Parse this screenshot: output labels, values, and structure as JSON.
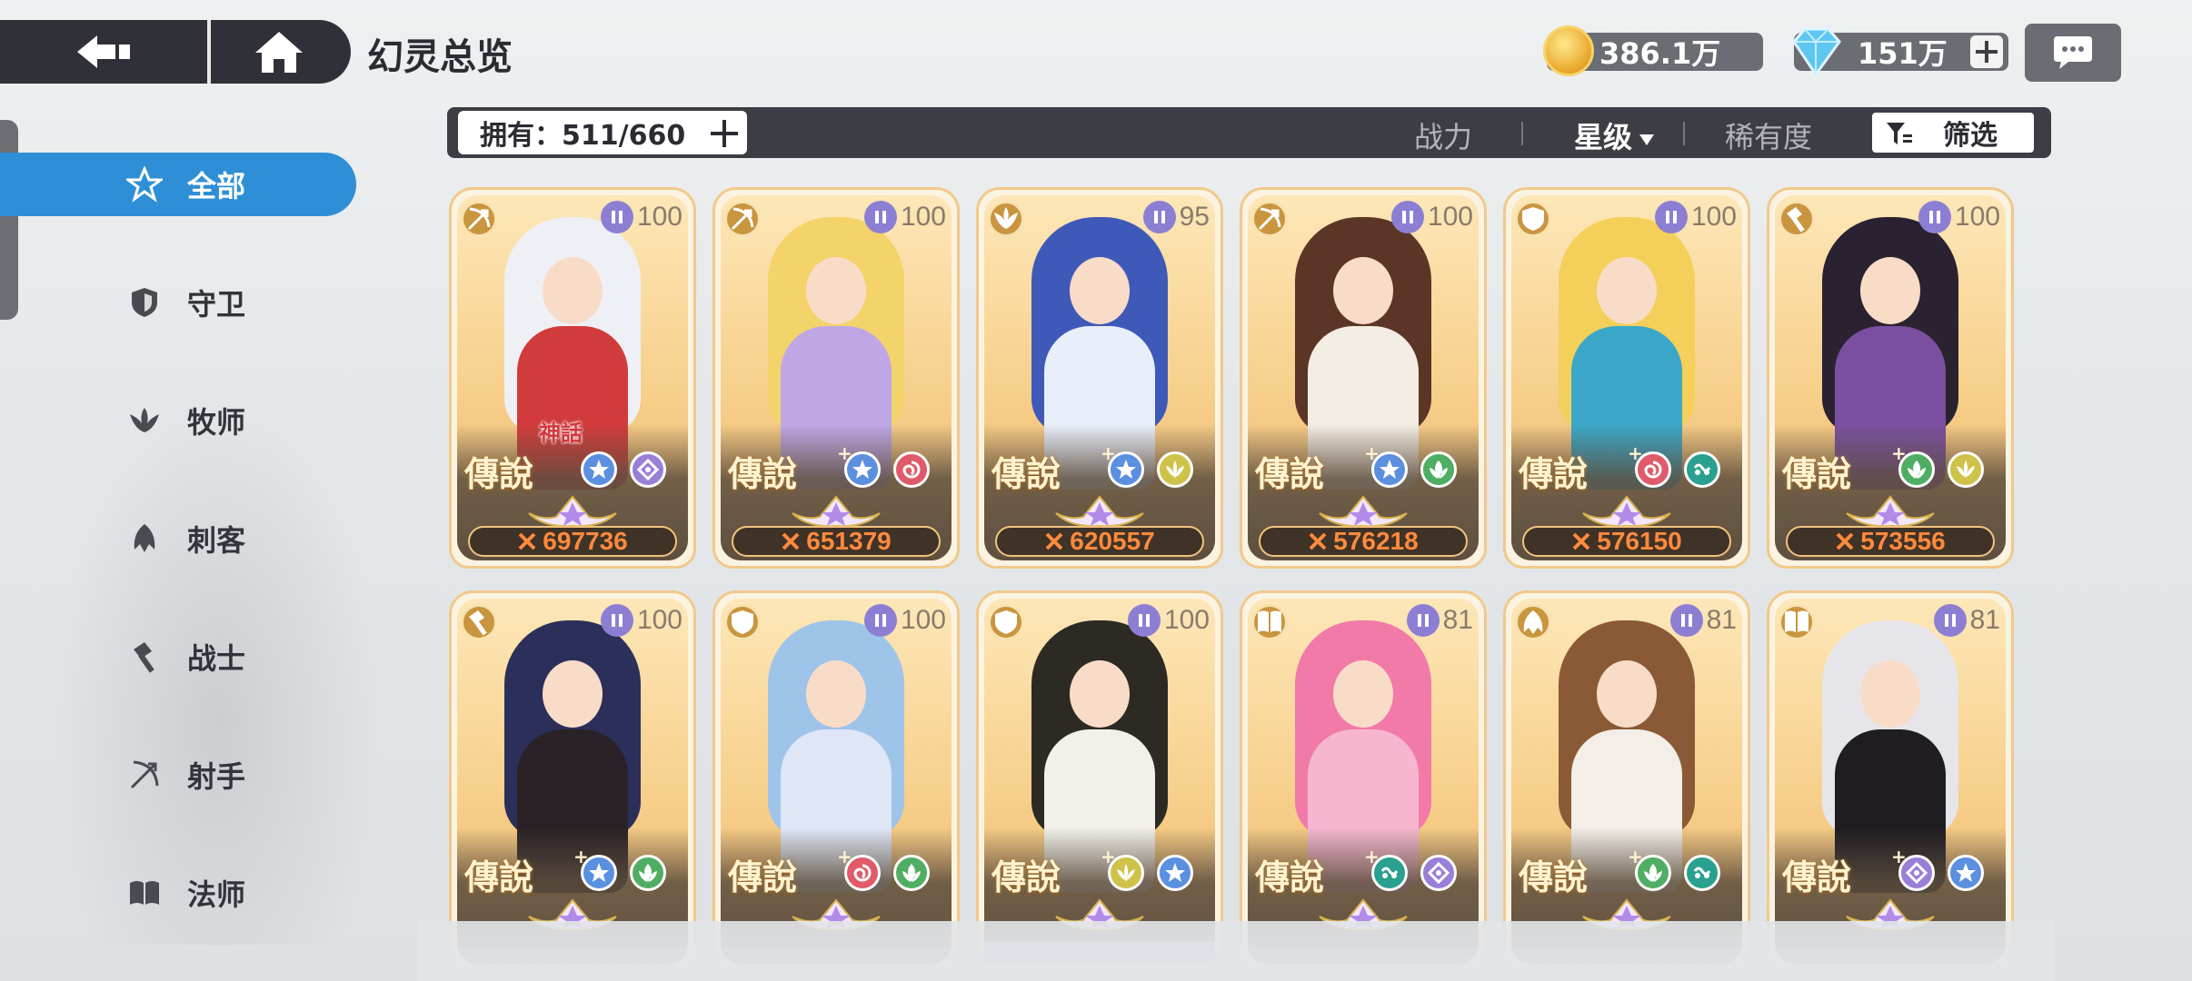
{
  "header": {
    "title": "幻灵总览",
    "gold": "386.1万",
    "gems": "151万"
  },
  "sidebar": {
    "items": [
      {
        "label": "全部",
        "icon": "all-star-icon",
        "active": true
      },
      {
        "label": "守卫",
        "icon": "shield-icon",
        "active": false
      },
      {
        "label": "牧师",
        "icon": "wing-icon",
        "active": false
      },
      {
        "label": "刺客",
        "icon": "assassin-icon",
        "active": false
      },
      {
        "label": "战士",
        "icon": "hammer-icon",
        "active": false
      },
      {
        "label": "射手",
        "icon": "bow-icon",
        "active": false
      },
      {
        "label": "法师",
        "icon": "book-icon",
        "active": false
      }
    ]
  },
  "filter_bar": {
    "owned": "拥有：511/660",
    "sort_power": "战力",
    "sort_star": "星级",
    "sort_rarity": "稀有度",
    "filter": "筛选",
    "active_sort": "星级"
  },
  "cards": [
    {
      "level": "100",
      "class_icon": "bow-icon",
      "rarity": "傳說",
      "plus": "",
      "myth": "神話",
      "elements": [
        "star-element-icon",
        "eye-element-icon"
      ],
      "power": "697736",
      "hair": "#eef0f6",
      "body": "#d23b3b"
    },
    {
      "level": "100",
      "class_icon": "bow-icon",
      "rarity": "傳說",
      "plus": "+",
      "myth": "",
      "elements": [
        "star-element-icon",
        "swirl-element-icon"
      ],
      "power": "651379",
      "hair": "#f3d36a",
      "body": "#bfa7e6"
    },
    {
      "level": "95",
      "class_icon": "wing-icon",
      "rarity": "傳說",
      "plus": "+",
      "myth": "",
      "elements": [
        "star-element-icon",
        "light-element-icon"
      ],
      "power": "620557",
      "hair": "#3f59b8",
      "body": "#e9eefb"
    },
    {
      "level": "100",
      "class_icon": "bow-icon",
      "rarity": "傳說",
      "plus": "+",
      "myth": "",
      "elements": [
        "star-element-icon",
        "leaf-element-icon"
      ],
      "power": "576218",
      "hair": "#5b3526",
      "body": "#f4ede3"
    },
    {
      "level": "100",
      "class_icon": "shield-icon",
      "rarity": "傳說",
      "plus": "+",
      "myth": "",
      "elements": [
        "swirl-element-icon",
        "wind-element-icon"
      ],
      "power": "576150",
      "hair": "#f4cf5a",
      "body": "#3aa7c9"
    },
    {
      "level": "100",
      "class_icon": "hammer-icon",
      "rarity": "傳說",
      "plus": "+",
      "myth": "",
      "elements": [
        "leaf-element-icon",
        "light-element-icon"
      ],
      "power": "573556",
      "hair": "#2a2230",
      "body": "#7b4fa0"
    },
    {
      "level": "100",
      "class_icon": "hammer-icon",
      "rarity": "傳說",
      "plus": "+",
      "myth": "",
      "elements": [
        "star-element-icon",
        "leaf-element-icon"
      ],
      "power": "",
      "hair": "#2c2f5a",
      "body": "#2a2226"
    },
    {
      "level": "100",
      "class_icon": "shield-icon",
      "rarity": "傳說",
      "plus": "+",
      "myth": "",
      "elements": [
        "swirl-element-icon",
        "leaf-element-icon"
      ],
      "power": "",
      "hair": "#9fc4ea",
      "body": "#dfe6f6"
    },
    {
      "level": "100",
      "class_icon": "shield-icon",
      "rarity": "傳說",
      "plus": "+",
      "myth": "",
      "elements": [
        "light-element-icon",
        "star-element-icon"
      ],
      "power": "",
      "hair": "#2d2a24",
      "body": "#f2f0ea"
    },
    {
      "level": "81",
      "class_icon": "book-icon",
      "rarity": "傳說",
      "plus": "+",
      "myth": "",
      "elements": [
        "wind-element-icon",
        "eye-element-icon"
      ],
      "power": "",
      "hair": "#f27aa8",
      "body": "#f6b6d0"
    },
    {
      "level": "81",
      "class_icon": "assassin-icon",
      "rarity": "傳說",
      "plus": "+",
      "myth": "",
      "elements": [
        "leaf-element-icon",
        "wind-element-icon"
      ],
      "power": "",
      "hair": "#8a5a36",
      "body": "#f3eee8"
    },
    {
      "level": "81",
      "class_icon": "book-icon",
      "rarity": "傳說",
      "plus": "+",
      "myth": "",
      "elements": [
        "eye-element-icon",
        "star-element-icon"
      ],
      "power": "",
      "hair": "#e6e6ea",
      "body": "#1f1c22"
    }
  ],
  "colors": {
    "accent": "#2f8fd6",
    "bar_dark": "#3c3d45",
    "power": "#ff8a3d",
    "card_border": "#f1c98a"
  }
}
